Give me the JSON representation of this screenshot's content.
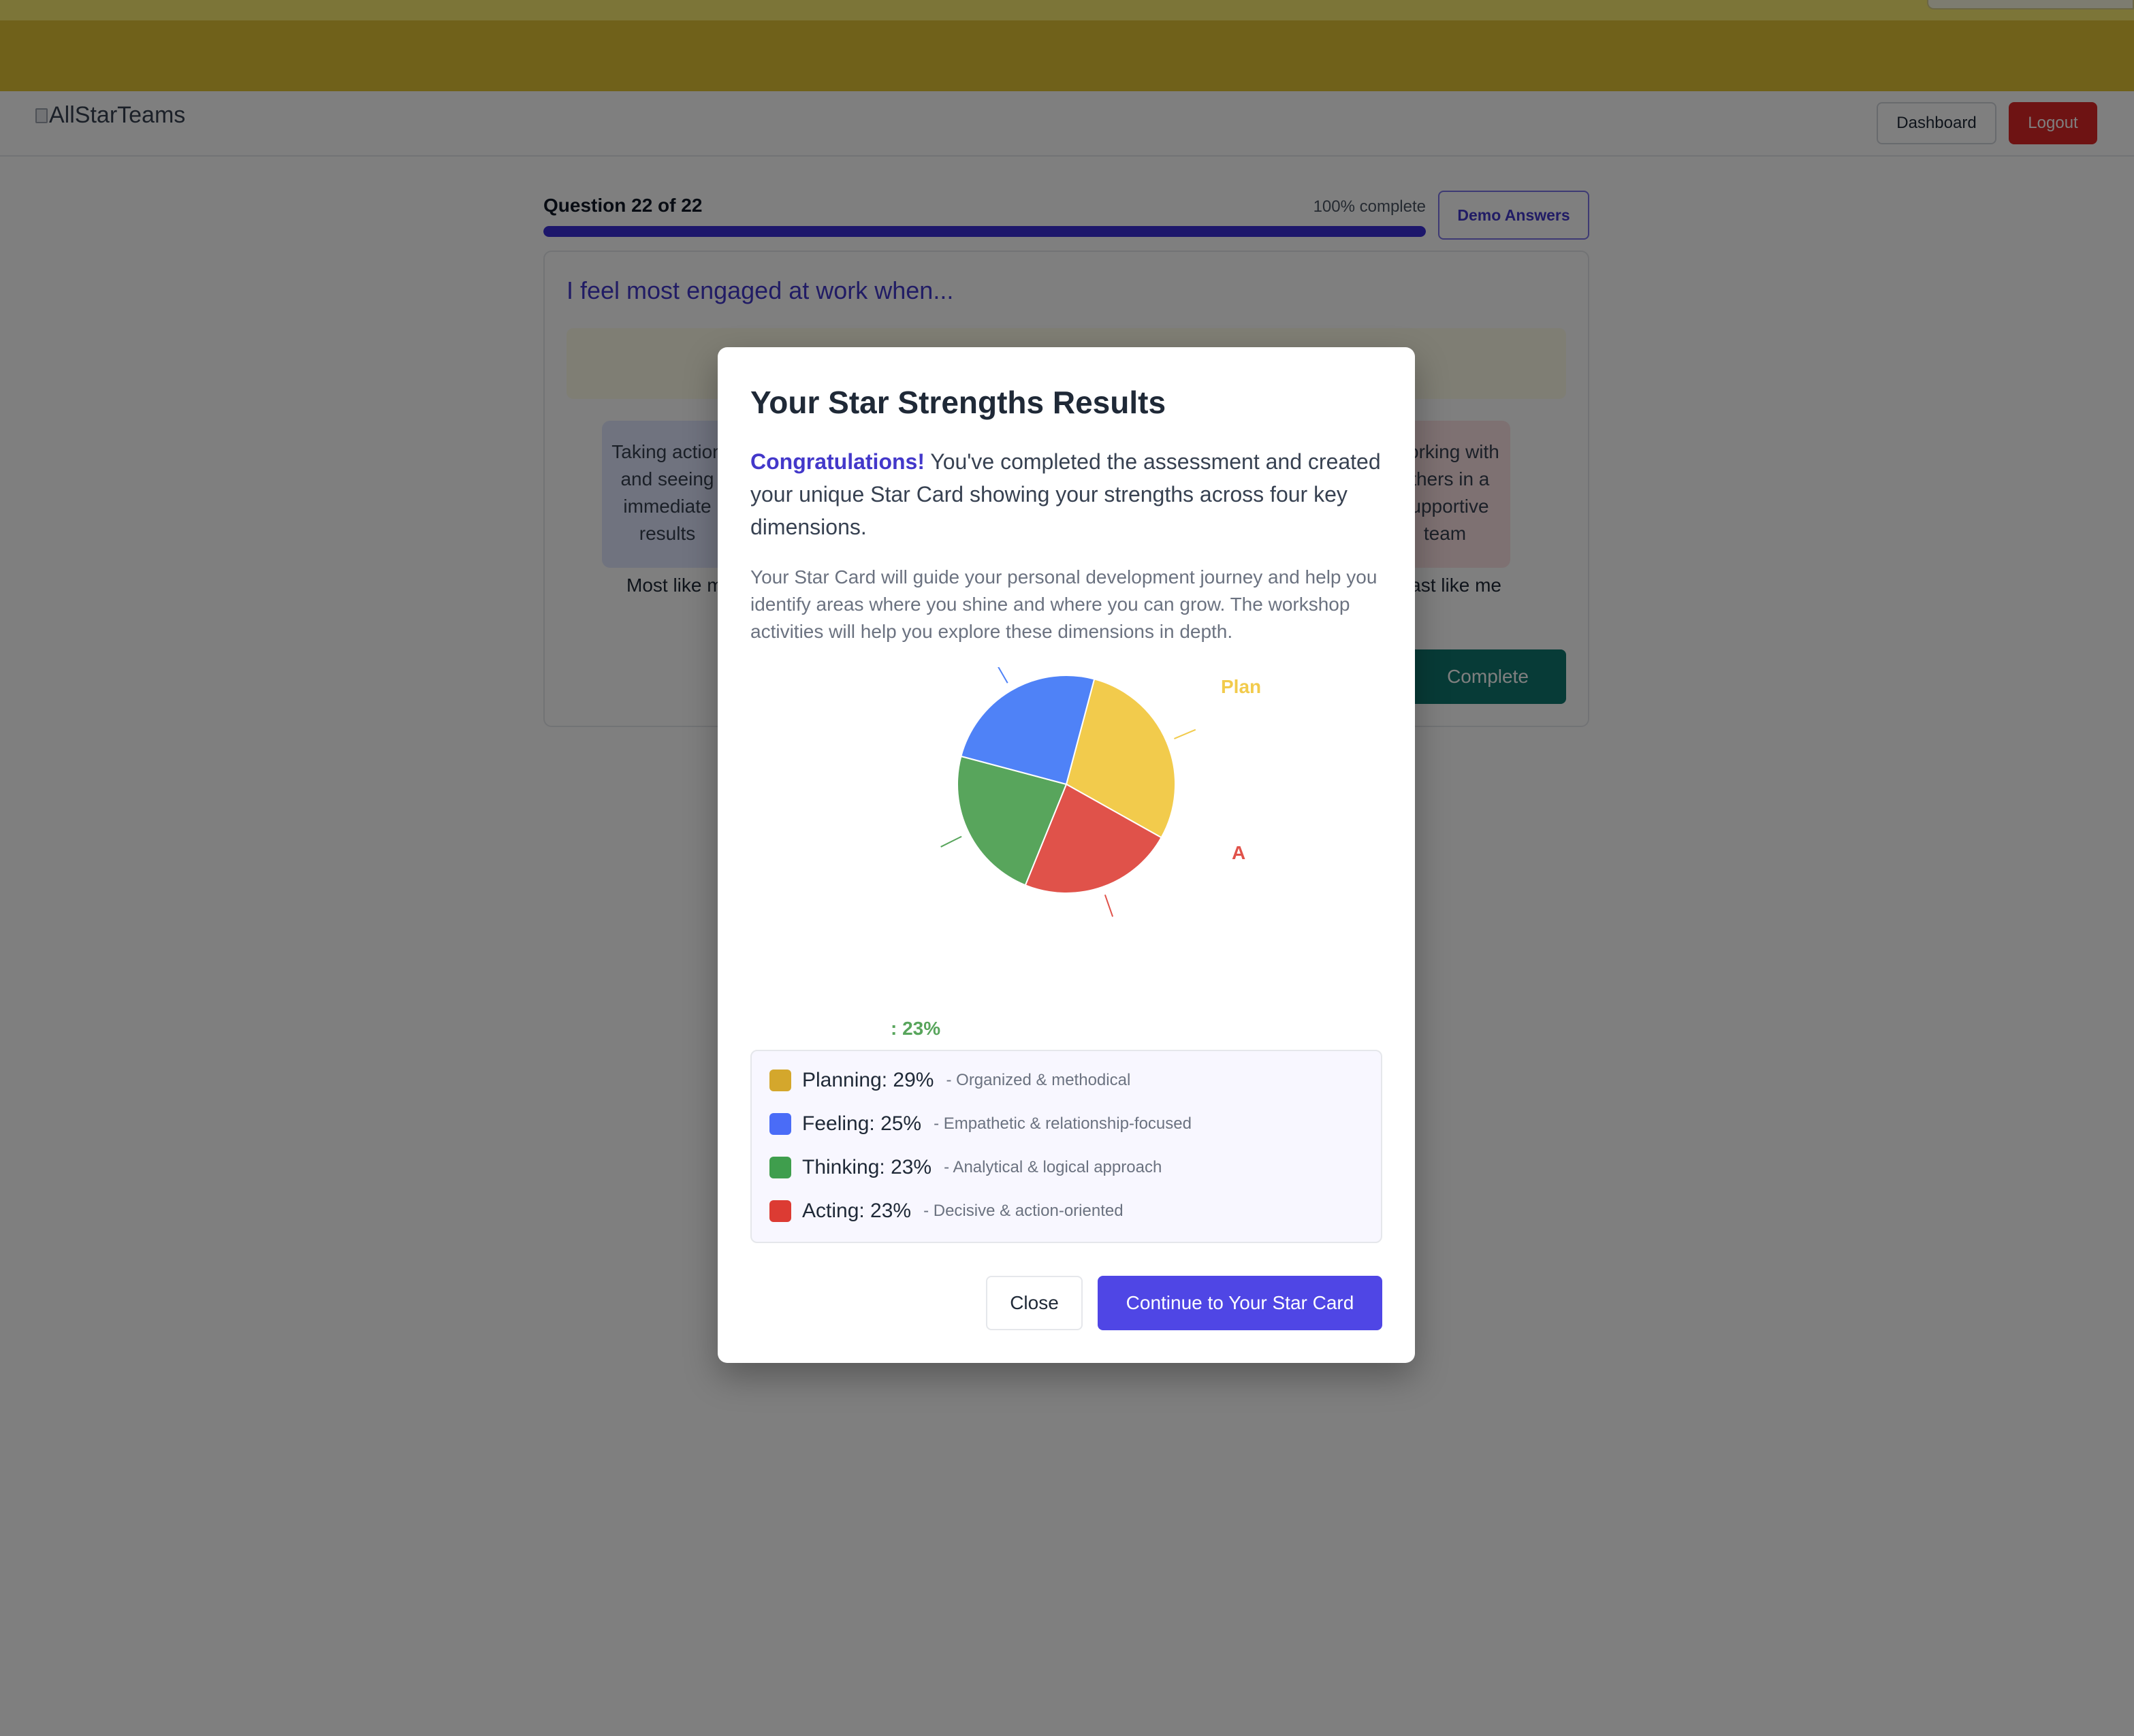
{
  "app": {
    "logo_alt": "AllStarTeams",
    "dashboard_label": "Dashboard",
    "logout_label": "Logout"
  },
  "assessment": {
    "counter": "Question 22 of 22",
    "percent_label": "100% complete",
    "progress_fraction": 1.0,
    "demo_label": "Demo Answers",
    "question": "I feel most engaged at work when...",
    "option_left_text": "Taking action and seeing immediate results",
    "option_right_text": "Working with others in a supportive team",
    "label_most": "Most like me",
    "label_least": "Least like me",
    "complete_label": "Complete"
  },
  "modal": {
    "title": "Your Star Strengths Results",
    "congrats": "Congratulations!",
    "intro": " You've completed the assessment and created your unique Star Card showing your strengths across four key dimensions.",
    "subtext": "Your Star Card will guide your personal development journey and help you identify areas where you shine and where you can grow. The workshop activities will help you explore these dimensions in depth.",
    "close_label": "Close",
    "continue_label": "Continue to Your Star Card",
    "legend": [
      {
        "name": "Planning: 29%",
        "desc": "- Organized & methodical",
        "color": "#d4a72c"
      },
      {
        "name": "Feeling: 25%",
        "desc": "- Empathetic & relationship-focused",
        "color": "#4a6cf7"
      },
      {
        "name": "Thinking: 23%",
        "desc": "- Analytical & logical approach",
        "color": "#3f9e4d"
      },
      {
        "name": "Acting: 23%",
        "desc": "- Decisive & action-oriented",
        "color": "#dc3b33"
      }
    ]
  },
  "chart_data": {
    "type": "pie",
    "categories": [
      "Planning",
      "Acting",
      "Thinking",
      "Feeling"
    ],
    "values": [
      29,
      23,
      23,
      25
    ],
    "colors": [
      "#f2cb4c",
      "#e0524a",
      "#58a55c",
      "#4f82f7"
    ],
    "visible_labels": [
      "Plan",
      "A",
      ": 23%",
      ""
    ],
    "label_colors": [
      "#f2cb4c",
      "#e0524a",
      "#58a55c",
      "#4f82f7"
    ]
  }
}
